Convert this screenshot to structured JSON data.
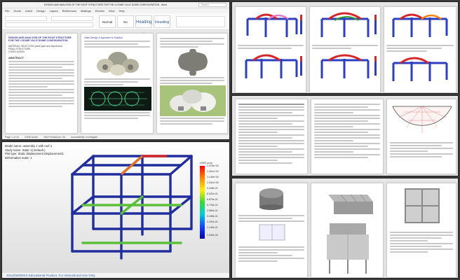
{
  "word_window": {
    "title_text": "DESIGN AND ANALYSIS OF THE ROOF STRUCTURE FOR THE 4 DOME VILLE DOME CONFIGURATION - Word",
    "search_placeholder": "Search",
    "tabs": [
      "File",
      "Home",
      "Insert",
      "Design",
      "Layout",
      "References",
      "Mailings",
      "Review",
      "View",
      "Help"
    ],
    "styles": [
      "Normal",
      "No Spacing",
      "Heading 1",
      "Heading 2"
    ],
    "status": [
      "Page 1 of 10",
      "3,645 words",
      "Text Predictions: On",
      "Accessibility: Investigate"
    ],
    "page1": {
      "title": "DESIGN AND ANALYSIS OF THE ROOF STRUCTURE FOR THE 4 DOME VILLE DOME CONFIGURATION",
      "meta1": "MATERIAL SELECTION (steel pipe and styrofoam)",
      "meta2": "FINAL STRUCTURE",
      "meta3": "CONCLUSION",
      "abstract_heading": "ABSTRACT"
    },
    "page2": {
      "heading": "Initial Design & Approach to Solution"
    }
  },
  "solidworks_window": {
    "title_lines": [
      "Model name: assembly 1 with roof 2",
      "Study name: Static 1(-Default-)",
      "Plot type: Static displacement Displacement1",
      "Deformation scale: 1"
    ],
    "legend_title": "URES (mm)",
    "legend_values": [
      "1.375e+00",
      "1.261e+00",
      "1.146e+00",
      "1.031e+00",
      "9.168e-01",
      "8.022e-01",
      "6.876e-01",
      "5.730e-01",
      "4.584e-01",
      "3.438e-01",
      "2.292e-01",
      "1.146e-01",
      "1.000e-30"
    ],
    "banner": "SOLIDWORKS Educational Product. For Instructional Use Only."
  },
  "colors": {
    "word_blue": "#2b579a",
    "frame_blue": "#1f2e9c",
    "accent_red": "#d62728"
  }
}
